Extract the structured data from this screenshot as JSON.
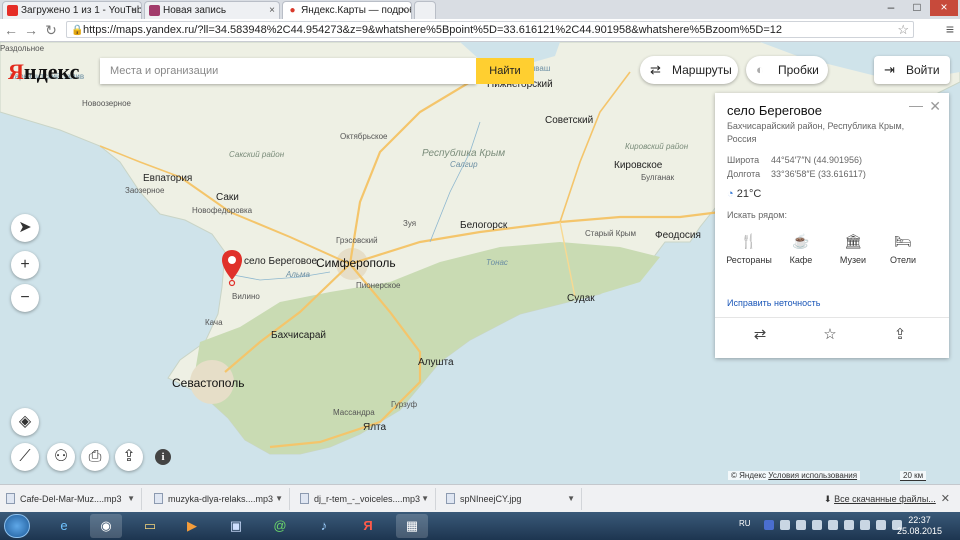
{
  "browser": {
    "tabs": [
      {
        "label": "Загружено 1 из 1 - YouTube",
        "icon": "youtube-icon",
        "color": "#e52d27"
      },
      {
        "label": "Новая запись",
        "icon": "diary-icon",
        "color": "#a23b6b"
      },
      {
        "label": "Яндекс.Карты — подроб",
        "icon": "map-pin-icon",
        "color": "#d93a2b"
      }
    ],
    "url": "https://maps.yandex.ru/?ll=34.583948%2C44.954273&z=9&whatshere%5Bpoint%5D=33.616121%2C44.901958&whatshere%5Bzoom%5D=12"
  },
  "yandex": {
    "logo_part1": "Я",
    "logo_part2": "ндекс",
    "search_placeholder": "Места и организации",
    "search_button": "Найти",
    "routes_label": "Маршруты",
    "traffic_label": "Пробки",
    "login_label": "Войти"
  },
  "map": {
    "labels": {
      "dzhankoy_frag": "Джанкой",
      "nizhnegorsky": "Нижнегорский",
      "razdolnoe": "Раздольное",
      "novoozernoe": "Новоозерное",
      "oktyabrskoe": "Октябрьское",
      "sovetsky": "Советский",
      "yevpatoria": "Евпатория",
      "zaozernoe": "Заозерное",
      "saki": "Саки",
      "novofedorovka": "Новофедоровка",
      "respublika_krym": "Республика Крым",
      "kirovskoe": "Кировское",
      "bulganak": "Булганак",
      "zuya": "Зуя",
      "belogorsk": "Белогорск",
      "stary_krym": "Старый Крым",
      "feodosia": "Феодосия",
      "grosovsky": "Грэсовский",
      "beregovoe": "село Береговое",
      "simferopol": "Симферополь",
      "pionerskoe": "Пионерское",
      "vilino": "Вилино",
      "sudak": "Судак",
      "kacha": "Кача",
      "bakhchisaray": "Бахчисарай",
      "alushta": "Алушта",
      "sevastopol": "Севастополь",
      "gurzuf": "Гурзуф",
      "massandra": "Массандра",
      "yalta": "Ялта",
      "karkinitsky_bay": "Каркинитский залив",
      "sivash": "Сиваш",
      "saki_district": "Сакский район",
      "kirovsky_district": "Кировский район",
      "salgir": "Салгир",
      "bulganak_river": "Булганак",
      "alma": "Альма",
      "zuya_river": "Зуя",
      "tonas": "Тонас"
    }
  },
  "place_card": {
    "title": "село Береговое",
    "address": "Бахчисарайский район, Республика Крым, Россия",
    "latitude_label": "Широта",
    "latitude_value": "44°54′7″N (44.901956)",
    "longitude_label": "Долгота",
    "longitude_value": "33°36′58″E (33.616117)",
    "temperature": "21°C",
    "nearby_label": "Искать рядом:",
    "categories": [
      {
        "label": "Рестораны",
        "icon": "restaurant-icon"
      },
      {
        "label": "Кафе",
        "icon": "cafe-icon"
      },
      {
        "label": "Музеи",
        "icon": "museum-icon"
      },
      {
        "label": "Отели",
        "icon": "hotel-icon"
      }
    ],
    "fix_link": "Исправить неточность"
  },
  "footer": {
    "copyright": "© Яндекс",
    "terms": "Условия использования",
    "scale": "20 км"
  },
  "downloads": {
    "items": [
      "Cafe-Del-Mar-Muz....mp3",
      "muzyka-dlya-relaks....mp3",
      "dj_r-tem_-_voiceles....mp3",
      "spNIneejCY.jpg"
    ],
    "show_all": "Все скачанные файлы..."
  },
  "taskbar": {
    "language": "RU",
    "time": "22:37",
    "date": "25.08.2015"
  },
  "colors": {
    "water": "#cfe3ea",
    "land": "#eef0e4",
    "forest": "#c9dbb3",
    "road_major": "#f4c56b",
    "search_accent": "#ffcf30",
    "pin": "#e0302a",
    "link": "#1a56b8"
  }
}
